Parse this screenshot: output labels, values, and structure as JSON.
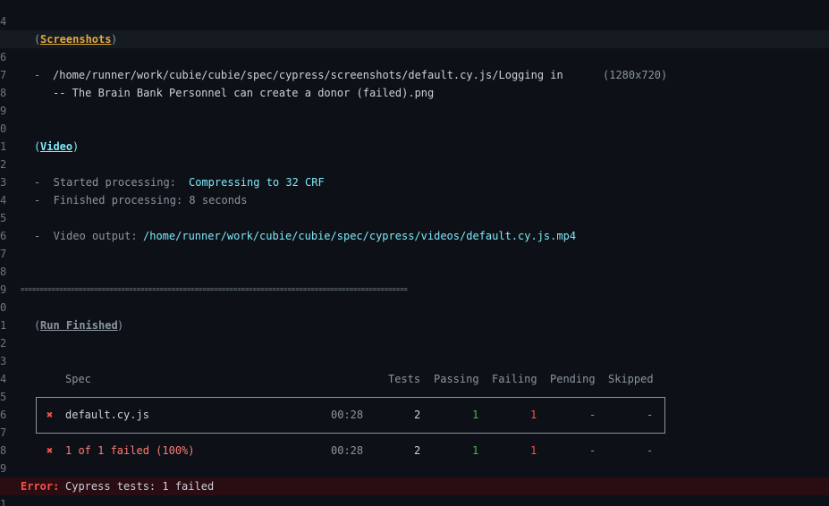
{
  "line_numbers": [
    "4",
    "5",
    "6",
    "7",
    "8",
    "9",
    "0",
    "1",
    "2",
    "3",
    "4",
    "5",
    "6",
    "7",
    "8",
    "9",
    "0",
    "1",
    "2",
    "3",
    "4",
    "5",
    "6",
    "7",
    "8",
    "9",
    "0",
    "1"
  ],
  "screenshots": {
    "open": "(",
    "title": "Screenshots",
    "close": ")",
    "bullet": "-",
    "path_line1": "/home/runner/work/cubie/cubie/spec/cypress/screenshots/default.cy.js/Logging in",
    "dimensions": "(1280x720)",
    "path_line2": "-- The Brain Bank Personnel can create a donor (failed).png"
  },
  "video": {
    "open": "(",
    "title": "Video",
    "close": ")",
    "started_label": "-  Started processing:",
    "started_value": "Compressing to 32 CRF",
    "finished_label": "-  Finished processing: 8 seconds",
    "output_label": "-  Video output:",
    "output_value": "/home/runner/work/cubie/cubie/spec/cypress/videos/default.cy.js.mp4"
  },
  "separator": "====================================================================================================",
  "run_finished": {
    "open": "(",
    "title": "Run Finished",
    "close": ")"
  },
  "table": {
    "headers": {
      "spec": "Spec",
      "tests": "Tests",
      "passing": "Passing",
      "failing": "Failing",
      "pending": "Pending",
      "skipped": "Skipped"
    },
    "row": {
      "icon": "✖",
      "spec": "default.cy.js",
      "duration": "00:28",
      "tests": "2",
      "passing": "1",
      "failing": "1",
      "pending": "-",
      "skipped": "-"
    },
    "summary": {
      "icon": "✖",
      "text": "1 of 1 failed (100%)",
      "duration": "00:28",
      "tests": "2",
      "passing": "1",
      "failing": "1",
      "pending": "-",
      "skipped": "-"
    }
  },
  "error": {
    "label": "Error:",
    "message": "Cypress tests: 1 failed"
  },
  "colors": {
    "background": "#0d1117",
    "cyan": "#7ee7f7",
    "green": "#3fb950",
    "red": "#f85149",
    "orange": "#e3a83a"
  }
}
